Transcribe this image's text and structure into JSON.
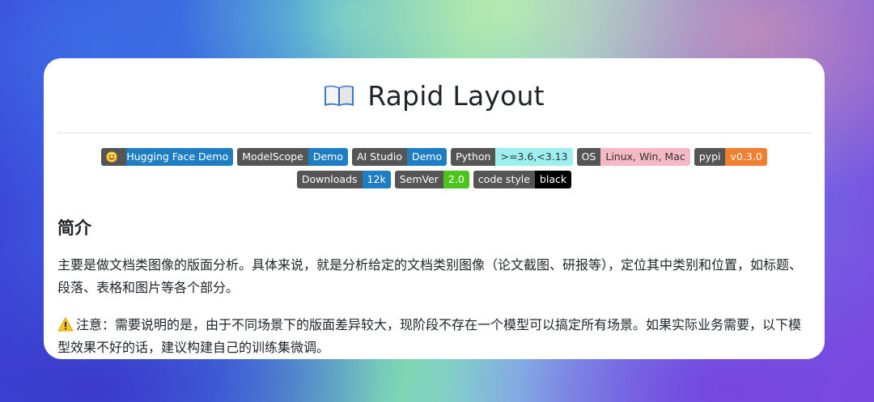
{
  "title": {
    "icon": "open-book-icon",
    "text": "Rapid Layout"
  },
  "badges": [
    {
      "icon": "hugging-face-icon",
      "left": "Hugging Face Demo",
      "right": "",
      "color": "#1f7ec1"
    },
    {
      "left": "ModelScope",
      "right": "Demo",
      "color": "#1f7ec1"
    },
    {
      "left": "AI Studio",
      "right": "Demo",
      "color": "#1f7ec1"
    },
    {
      "left": "Python",
      "right": ">=3.6,<3.13",
      "color": "#9ef0f0",
      "right_text": "#333333"
    },
    {
      "left": "OS",
      "right": "Linux, Win, Mac",
      "color": "#f5b8c5",
      "right_text": "#333333"
    },
    {
      "left": "pypi",
      "right": "v0.3.0",
      "color": "#f07f2f"
    },
    {
      "left": "Downloads",
      "right": "12k",
      "color": "#1f7ec1"
    },
    {
      "left": "SemVer",
      "right": "2.0",
      "color": "#4bc51d"
    },
    {
      "left": "code style",
      "right": "black",
      "color": "#000000"
    }
  ],
  "section": {
    "heading": "简介",
    "paragraph1": "主要是做文档类图像的版面分析。具体来说，就是分析给定的文档类别图像（论文截图、研报等），定位其中类别和位置，如标题、段落、表格和图片等各个部分。",
    "warning_icon": "warning-icon",
    "paragraph2": "注意：需要说明的是，由于不同场景下的版面差异较大，现阶段不存在一个模型可以搞定所有场景。如果实际业务需要，以下模型效果不好的话，建议构建自己的训练集微调。"
  }
}
